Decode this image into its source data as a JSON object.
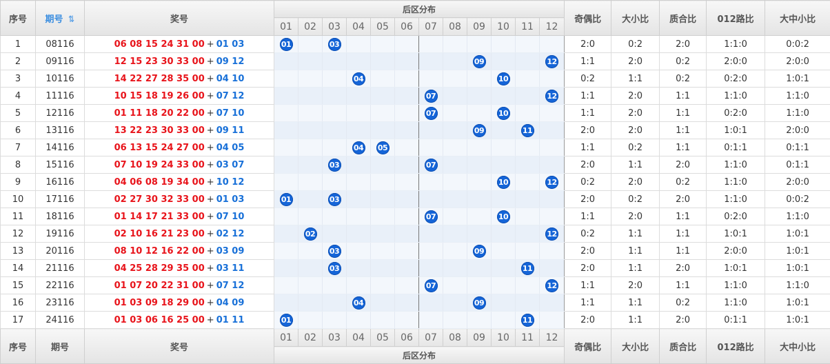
{
  "headers": {
    "seq": "序号",
    "issue": "期号",
    "draw": "奖号",
    "zone": "后区分布",
    "odd_even": "奇偶比",
    "big_small": "大小比",
    "prime_composite": "质合比",
    "road012": "012路比",
    "big_mid_small": "大中小比",
    "sort_icon": "⇅"
  },
  "zone_numbers": [
    "01",
    "02",
    "03",
    "04",
    "05",
    "06",
    "07",
    "08",
    "09",
    "10",
    "11",
    "12"
  ],
  "colors": {
    "ball": "#1565d8",
    "front": "#e8141b",
    "back": "#1870d8",
    "issue_header": "#3b8ee0"
  },
  "rows": [
    {
      "seq": "1",
      "issue": "08116",
      "front": "06 08 15 24 31 00",
      "back": "01 03",
      "balls": [
        "01",
        "03"
      ],
      "ratios": [
        "2:0",
        "0:2",
        "2:0",
        "1:1:0",
        "0:0:2"
      ]
    },
    {
      "seq": "2",
      "issue": "09116",
      "front": "12 15 23 30 33 00",
      "back": "09 12",
      "balls": [
        "09",
        "12"
      ],
      "ratios": [
        "1:1",
        "2:0",
        "0:2",
        "2:0:0",
        "2:0:0"
      ]
    },
    {
      "seq": "3",
      "issue": "10116",
      "front": "14 22 27 28 35 00",
      "back": "04 10",
      "balls": [
        "04",
        "10"
      ],
      "ratios": [
        "0:2",
        "1:1",
        "0:2",
        "0:2:0",
        "1:0:1"
      ]
    },
    {
      "seq": "4",
      "issue": "11116",
      "front": "10 15 18 19 26 00",
      "back": "07 12",
      "balls": [
        "07",
        "12"
      ],
      "ratios": [
        "1:1",
        "2:0",
        "1:1",
        "1:1:0",
        "1:1:0"
      ]
    },
    {
      "seq": "5",
      "issue": "12116",
      "front": "01 11 18 20 22 00",
      "back": "07 10",
      "balls": [
        "07",
        "10"
      ],
      "ratios": [
        "1:1",
        "2:0",
        "1:1",
        "0:2:0",
        "1:1:0"
      ]
    },
    {
      "seq": "6",
      "issue": "13116",
      "front": "13 22 23 30 33 00",
      "back": "09 11",
      "balls": [
        "09",
        "11"
      ],
      "ratios": [
        "2:0",
        "2:0",
        "1:1",
        "1:0:1",
        "2:0:0"
      ]
    },
    {
      "seq": "7",
      "issue": "14116",
      "front": "06 13 15 24 27 00",
      "back": "04 05",
      "balls": [
        "04",
        "05"
      ],
      "ratios": [
        "1:1",
        "0:2",
        "1:1",
        "0:1:1",
        "0:1:1"
      ]
    },
    {
      "seq": "8",
      "issue": "15116",
      "front": "07 10 19 24 33 00",
      "back": "03 07",
      "balls": [
        "03",
        "07"
      ],
      "ratios": [
        "2:0",
        "1:1",
        "2:0",
        "1:1:0",
        "0:1:1"
      ]
    },
    {
      "seq": "9",
      "issue": "16116",
      "front": "04 06 08 19 34 00",
      "back": "10 12",
      "balls": [
        "10",
        "12"
      ],
      "ratios": [
        "0:2",
        "2:0",
        "0:2",
        "1:1:0",
        "2:0:0"
      ]
    },
    {
      "seq": "10",
      "issue": "17116",
      "front": "02 27 30 32 33 00",
      "back": "01 03",
      "balls": [
        "01",
        "03"
      ],
      "ratios": [
        "2:0",
        "0:2",
        "2:0",
        "1:1:0",
        "0:0:2"
      ]
    },
    {
      "seq": "11",
      "issue": "18116",
      "front": "01 14 17 21 33 00",
      "back": "07 10",
      "balls": [
        "07",
        "10"
      ],
      "ratios": [
        "1:1",
        "2:0",
        "1:1",
        "0:2:0",
        "1:1:0"
      ]
    },
    {
      "seq": "12",
      "issue": "19116",
      "front": "02 10 16 21 23 00",
      "back": "02 12",
      "balls": [
        "02",
        "12"
      ],
      "ratios": [
        "0:2",
        "1:1",
        "1:1",
        "1:0:1",
        "1:0:1"
      ]
    },
    {
      "seq": "13",
      "issue": "20116",
      "front": "08 10 12 16 22 00",
      "back": "03 09",
      "balls": [
        "03",
        "09"
      ],
      "ratios": [
        "2:0",
        "1:1",
        "1:1",
        "2:0:0",
        "1:0:1"
      ]
    },
    {
      "seq": "14",
      "issue": "21116",
      "front": "04 25 28 29 35 00",
      "back": "03 11",
      "balls": [
        "03",
        "11"
      ],
      "ratios": [
        "2:0",
        "1:1",
        "2:0",
        "1:0:1",
        "1:0:1"
      ]
    },
    {
      "seq": "15",
      "issue": "22116",
      "front": "01 07 20 22 31 00",
      "back": "07 12",
      "balls": [
        "07",
        "12"
      ],
      "ratios": [
        "1:1",
        "2:0",
        "1:1",
        "1:1:0",
        "1:1:0"
      ]
    },
    {
      "seq": "16",
      "issue": "23116",
      "front": "01 03 09 18 29 00",
      "back": "04 09",
      "balls": [
        "04",
        "09"
      ],
      "ratios": [
        "1:1",
        "1:1",
        "0:2",
        "1:1:0",
        "1:0:1"
      ]
    },
    {
      "seq": "17",
      "issue": "24116",
      "front": "01 03 06 16 25 00",
      "back": "01 11",
      "balls": [
        "01",
        "11"
      ],
      "ratios": [
        "2:0",
        "1:1",
        "2:0",
        "0:1:1",
        "1:0:1"
      ]
    }
  ]
}
